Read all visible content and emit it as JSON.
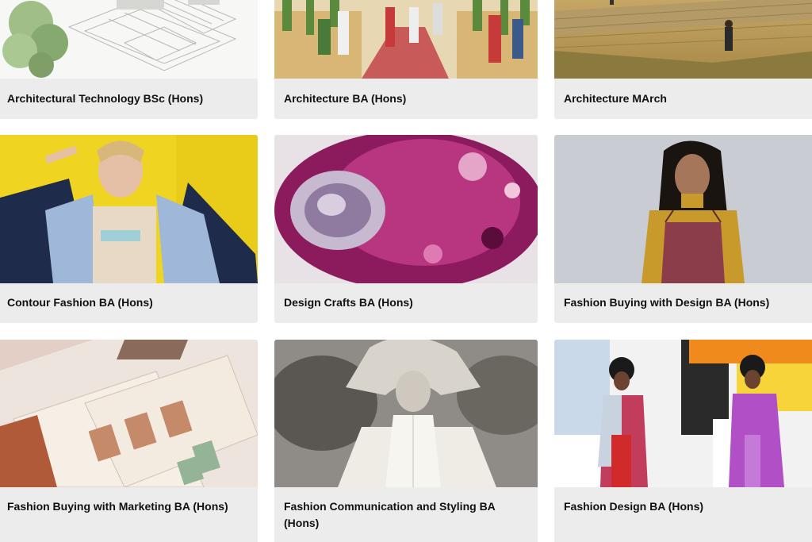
{
  "courses": [
    {
      "title": "Architectural Technology BSc (Hons)",
      "image": "isometric-building-sketch"
    },
    {
      "title": "Architecture BA (Hons)",
      "image": "street-market-illustration"
    },
    {
      "title": "Architecture MArch",
      "image": "landscape-walkway-render"
    },
    {
      "title": "Contour Fashion BA (Hons)",
      "image": "model-yellow-background"
    },
    {
      "title": "Design Crafts BA (Hons)",
      "image": "magenta-glass-sculpture"
    },
    {
      "title": "Fashion Buying with Design BA (Hons)",
      "image": "model-mustard-top"
    },
    {
      "title": "Fashion Buying with Marketing BA (Hons)",
      "image": "fashion-sketch-boards"
    },
    {
      "title": "Fashion Communication and Styling BA (Hons)",
      "image": "monochrome-portrait"
    },
    {
      "title": "Fashion Design BA (Hons)",
      "image": "two-models-colour-blocks"
    }
  ]
}
